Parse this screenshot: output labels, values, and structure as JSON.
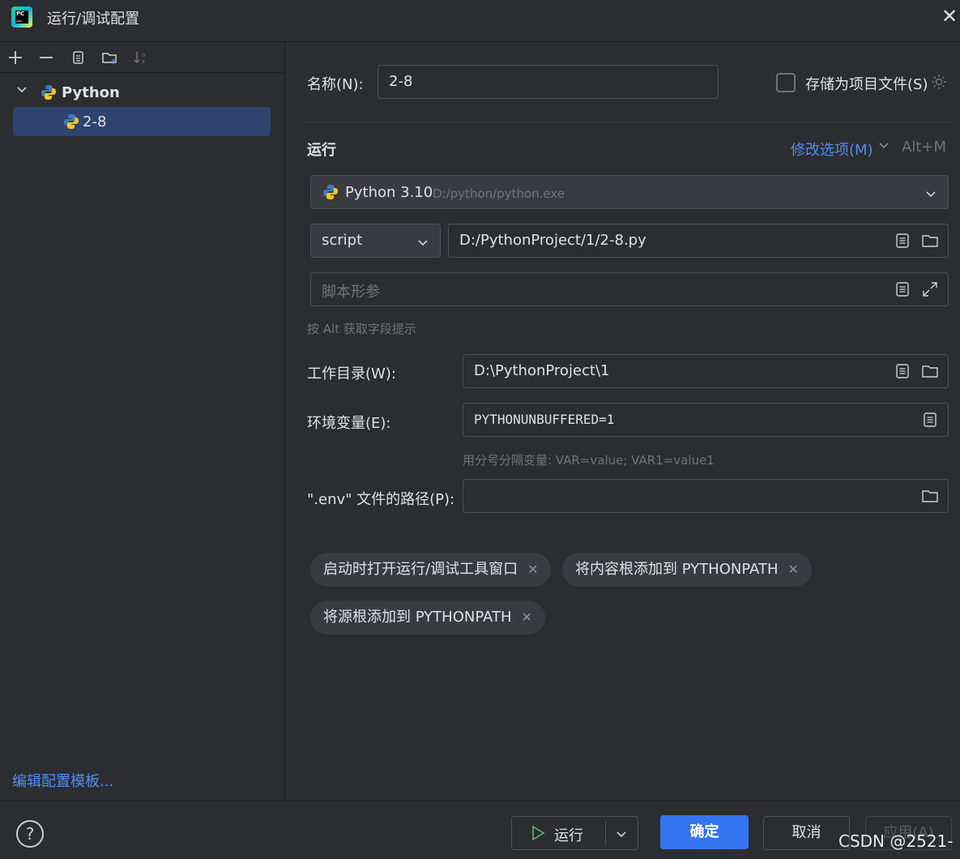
{
  "window": {
    "title": "运行/调试配置"
  },
  "tree": {
    "group_label": "Python",
    "selected_item": "2-8"
  },
  "left": {
    "edit_templates": "编辑配置模板..."
  },
  "form": {
    "name_label": "名称(N):",
    "name_value": "2-8",
    "store_label": "存储为项目文件(S)",
    "run_section": "运行",
    "modify_options": "修改选项(M)",
    "modify_shortcut": "Alt+M",
    "interpreter_name": "Python 3.10",
    "interpreter_path": "D:/python/python.exe",
    "script_type": "script",
    "script_path": "D:/PythonProject/1/2-8.py",
    "script_params_placeholder": "脚本形参",
    "alt_hint": "按 Alt 获取字段提示",
    "workdir_label": "工作目录(W):",
    "workdir_value": "D:\\PythonProject\\1",
    "env_label": "环境变量(E):",
    "env_value": "PYTHONUNBUFFERED=1",
    "env_hint": "用分号分隔变量: VAR=value; VAR1=value1",
    "dotenv_label": "\".env\" 文件的路径(P):",
    "dotenv_value": ""
  },
  "chips": [
    "启动时打开运行/调试工具窗口",
    "将内容根添加到 PYTHONPATH",
    "将源根添加到 PYTHONPATH"
  ],
  "buttons": {
    "help": "?",
    "run": "运行",
    "ok": "确定",
    "cancel": "取消",
    "apply": "应用(A)"
  },
  "watermark": "CSDN @2521-",
  "colors": {
    "accent": "#3574f0",
    "link": "#548af7",
    "selection": "#2e436e",
    "background": "#2b2d30"
  }
}
